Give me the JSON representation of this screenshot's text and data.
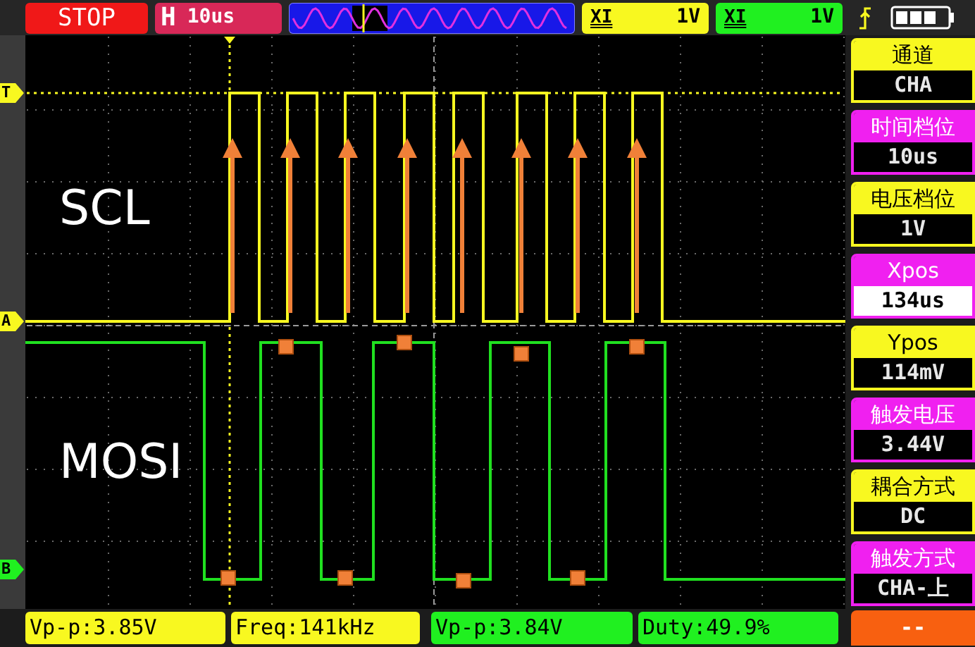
{
  "top_bar": {
    "run_state": "STOP",
    "timebase": {
      "label": "H",
      "value": "10us"
    },
    "channels": [
      {
        "coupling": "XI",
        "scale": "1V",
        "color": "#f8f820"
      },
      {
        "coupling": "XI",
        "scale": "1V",
        "color": "#20f020"
      }
    ]
  },
  "plot": {
    "markers": [
      {
        "label": "T",
        "color": "#f8f820"
      },
      {
        "label": "A",
        "color": "#f8f820"
      },
      {
        "label": "B",
        "color": "#20f020"
      }
    ],
    "signal_labels": [
      "SCL",
      "MOSI"
    ]
  },
  "menu": [
    {
      "label": "通道",
      "value": "CHA",
      "color": "#f8f820",
      "selected": false
    },
    {
      "label": "时间档位",
      "value": "10us",
      "color": "#f020f0",
      "selected": false
    },
    {
      "label": "电压档位",
      "value": "1V",
      "color": "#f8f820",
      "selected": false
    },
    {
      "label": "Xpos",
      "value": "134us",
      "color": "#f020f0",
      "selected": true
    },
    {
      "label": "Ypos",
      "value": "114mV",
      "color": "#f8f820",
      "selected": false
    },
    {
      "label": "触发电压",
      "value": "3.44V",
      "color": "#f020f0",
      "selected": false
    },
    {
      "label": "耦合方式",
      "value": "DC",
      "color": "#f8f820",
      "selected": false
    },
    {
      "label": "触发方式",
      "value": "CHA-上",
      "color": "#f020f0",
      "selected": false
    }
  ],
  "measurements": [
    {
      "text": "Vp-p:3.85V",
      "color": "#f8f820"
    },
    {
      "text": "Freq:141kHz",
      "color": "#f8f820"
    },
    {
      "text": "Vp-p:3.84V",
      "color": "#20f020"
    },
    {
      "text": "Duty:49.9%",
      "color": "#20f020"
    }
  ],
  "status_button": "--"
}
